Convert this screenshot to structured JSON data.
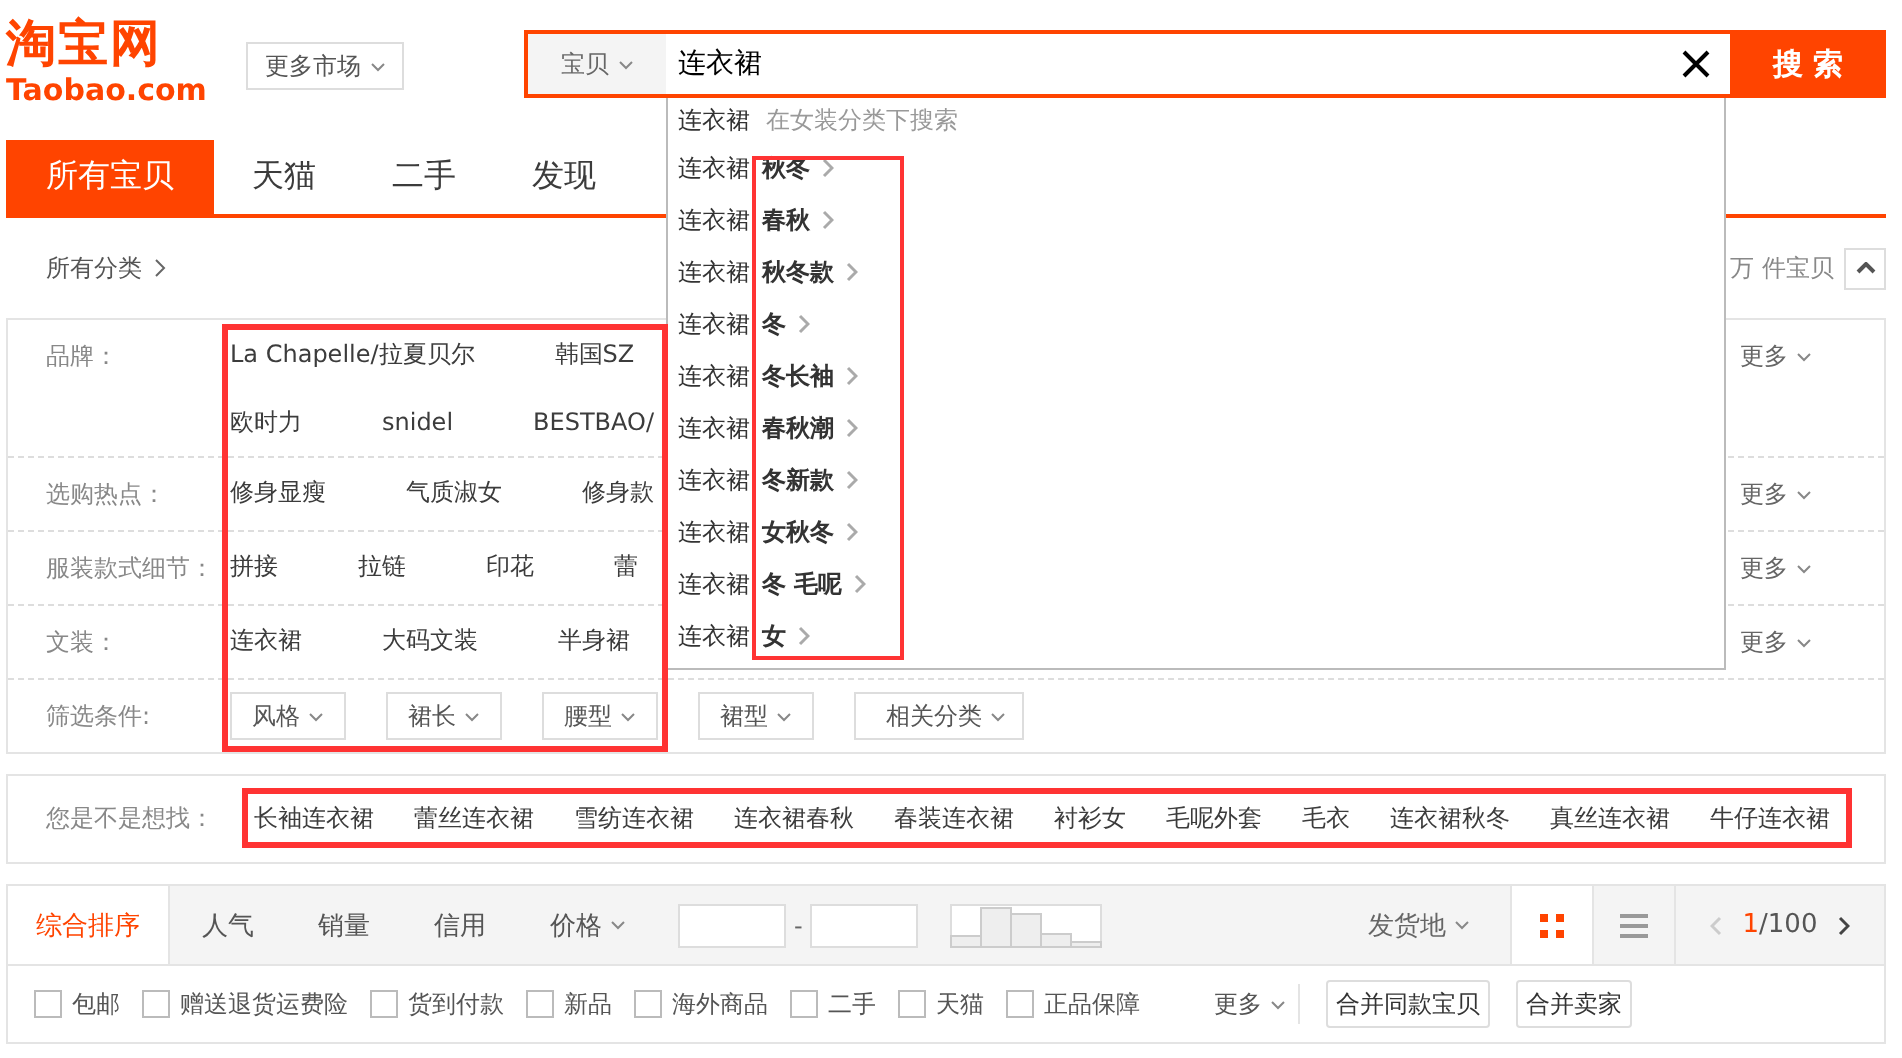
{
  "logo": {
    "title": "淘宝网",
    "subtitle": "Taobao.com"
  },
  "market_button": "更多市场",
  "search": {
    "scope": "宝贝",
    "value": "连衣裙",
    "button": "搜 索"
  },
  "suggestions": {
    "term": "连衣裙",
    "hint": "在女装分类下搜索",
    "items": [
      "连衣裙**秋冬**",
      "连衣裙**春秋**",
      "连衣裙**秋冬款**",
      "连衣裙**冬**",
      "连衣裙**冬长袖**",
      "连衣裙**春秋潮**",
      "连衣裙**冬新款**",
      "连衣裙**女秋冬**",
      "连衣裙**冬 毛呢**",
      "连衣裙**女**"
    ]
  },
  "tabs": [
    {
      "label": "所有宝贝",
      "selected": true
    },
    {
      "label": "天猫",
      "selected": false
    },
    {
      "label": "二手",
      "selected": false
    },
    {
      "label": "发现",
      "selected": false
    }
  ],
  "breadcrumb": "所有分类",
  "result_count": "万 件宝贝",
  "filters": [
    {
      "kind": "values",
      "label": "品牌：",
      "lines": [
        [
          "La Chapelle/拉夏贝尔",
          "韩国SZ"
        ],
        [
          "欧时力",
          "snidel",
          "BESTBAO/"
        ]
      ],
      "more": "更多"
    },
    {
      "kind": "values",
      "label": "选购热点：",
      "lines": [
        [
          "修身显瘦",
          "气质淑女",
          "修身款"
        ]
      ],
      "more": "更多"
    },
    {
      "kind": "values",
      "label": "服装款式细节：",
      "lines": [
        [
          "拼接",
          "拉链",
          "印花",
          "蕾"
        ]
      ],
      "more": "更多"
    },
    {
      "kind": "values",
      "label": "文装：",
      "lines": [
        [
          "连衣裙",
          "大码文装",
          "半身裙"
        ]
      ],
      "more": "更多"
    },
    {
      "kind": "dropdowns",
      "label": "筛选条件:",
      "options": [
        "风格",
        "裙长",
        "腰型",
        "裙型",
        "相关分类"
      ]
    }
  ],
  "did_you_mean": {
    "label": "您是不是想找：",
    "items": [
      "长袖连衣裙",
      "蕾丝连衣裙",
      "雪纺连衣裙",
      "连衣裙春秋",
      "春装连衣裙",
      "衬衫女",
      "毛呢外套",
      "毛衣",
      "连衣裙秋冬",
      "真丝连衣裙",
      "牛仔连衣裙"
    ]
  },
  "sort": {
    "options": [
      {
        "label": "综合排序",
        "kind": "plain",
        "selected": true
      },
      {
        "label": "人气",
        "kind": "plain",
        "selected": false
      },
      {
        "label": "销量",
        "kind": "plain",
        "selected": false
      },
      {
        "label": "信用",
        "kind": "plain",
        "selected": false
      },
      {
        "label": "价格",
        "kind": "dropdown",
        "selected": false
      }
    ],
    "price_separator": "-",
    "location": "发货地",
    "views": [
      {
        "kind": "grid",
        "selected": true
      },
      {
        "kind": "list",
        "selected": false
      }
    ],
    "page_current": "1",
    "page_total": "/100"
  },
  "checkboxes": [
    {
      "label": "包邮",
      "checked": false
    },
    {
      "label": "赠送退货运费险",
      "checked": false
    },
    {
      "label": "货到付款",
      "checked": false
    },
    {
      "label": "新品",
      "checked": false
    },
    {
      "label": "海外商品",
      "checked": false
    },
    {
      "label": "二手",
      "checked": false
    },
    {
      "label": "天猫",
      "checked": false
    },
    {
      "label": "正品保障",
      "checked": false
    }
  ],
  "more": "更多",
  "buttons": [
    "合并同款宝贝",
    "合并卖家"
  ]
}
